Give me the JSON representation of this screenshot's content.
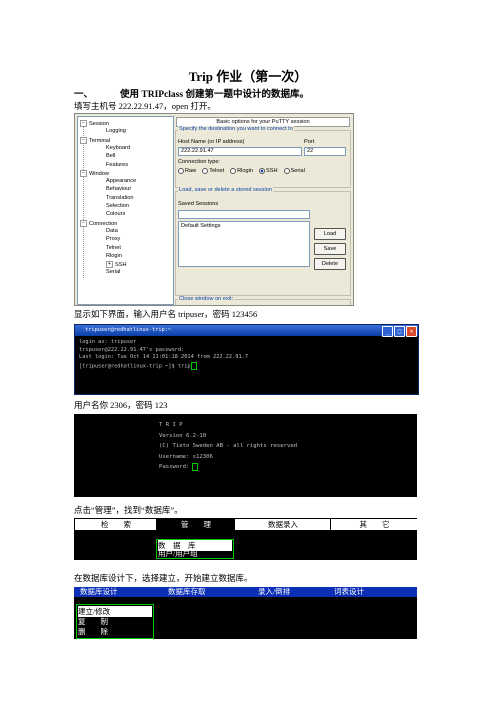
{
  "title": "Trip 作业（第一次）",
  "heading": {
    "number": "一、",
    "text": "使用 TRIPclass 创建第一题中设计的数据库。"
  },
  "para1": "填写主机号 222.22.91.47，open 打开。",
  "putty": {
    "tree": [
      {
        "label": "Session",
        "expander": "⊟",
        "level": 0
      },
      {
        "label": "Logging",
        "level": 1
      },
      {
        "label": "Terminal",
        "expander": "⊟",
        "level": 0
      },
      {
        "label": "Keyboard",
        "level": 1
      },
      {
        "label": "Bell",
        "level": 1
      },
      {
        "label": "Features",
        "level": 1
      },
      {
        "label": "Window",
        "expander": "⊟",
        "level": 0
      },
      {
        "label": "Appearance",
        "level": 1
      },
      {
        "label": "Behaviour",
        "level": 1
      },
      {
        "label": "Translation",
        "level": 1
      },
      {
        "label": "Selection",
        "level": 1
      },
      {
        "label": "Colours",
        "level": 1
      },
      {
        "label": "Connection",
        "expander": "⊟",
        "level": 0
      },
      {
        "label": "Data",
        "level": 1
      },
      {
        "label": "Proxy",
        "level": 1
      },
      {
        "label": "Telnet",
        "level": 1
      },
      {
        "label": "Rlogin",
        "level": 1
      },
      {
        "label": "SSH",
        "expander": "⊞",
        "level": 1
      },
      {
        "label": "Serial",
        "level": 1
      }
    ],
    "banner": "Basic options for your PuTTY session",
    "dest_group": "Specify the destination you want to connect to",
    "host_label": "Host Name (or IP address)",
    "port_label": "Port",
    "host_value": "222.22.91.47",
    "port_value": "22",
    "conn_type_label": "Connection type:",
    "conn_types": [
      "Raw",
      "Telnet",
      "Rlogin",
      "SSH",
      "Serial"
    ],
    "conn_selected": "SSH",
    "session_group": "Load, save or delete a stored session",
    "saved_label": "Saved Sessions",
    "saved_input": "",
    "sessions": [
      "Default Settings"
    ],
    "btn_load": "Load",
    "btn_save": "Save",
    "btn_delete": "Delete",
    "close_label": "Close window on exit:"
  },
  "para2": "显示如下界面，输入用户名 tripuser，密码 123456",
  "terminal": {
    "title": "tripuser@redhatlinux-trip:~",
    "lines": [
      "login as: tripuser",
      "tripuser@222.22.91.47's password:",
      "Last login: Tue Oct 14 11:01:18 2014 from 222.22.91.7",
      "[tripuser@redhatlinux-trip ~]$ trip"
    ]
  },
  "para3": "用户名你 2306，密码 123",
  "trip_screen": {
    "lines": [
      "T R I P",
      "Version 6.2-10",
      "(C) Tieto Sweden AB - all rights reserved",
      "Username: s12306",
      "Password:"
    ]
  },
  "para4": "点击“管理”，找到“数据库”。",
  "menu1": {
    "items": [
      "检　　索",
      "管　　理",
      "数据录入",
      "其　　它"
    ],
    "dropdown": [
      "数　据　库",
      "用户/用户组"
    ]
  },
  "para5": "在数据库设计下，选择建立，开始建立数据库。",
  "menu2": {
    "items": [
      "数据库设计",
      "数据库存取",
      "录入/倒排",
      "词表设计"
    ],
    "dropdown": [
      "建立/修改",
      "复　　制",
      "删　　除"
    ]
  }
}
